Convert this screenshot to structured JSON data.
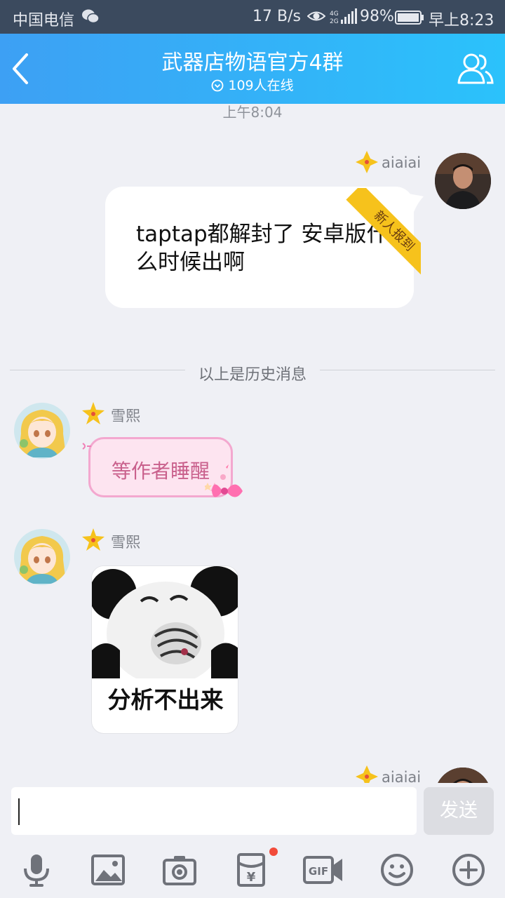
{
  "status_bar": {
    "carrier": "中国电信",
    "net_speed": "17 B/s",
    "network_type_top": "4G",
    "network_type_bottom": "2G",
    "battery": "98%",
    "time": "早上8:23"
  },
  "header": {
    "title": "武器店物语官方4群",
    "online": "109人在线"
  },
  "chat": {
    "time_label": "上午8:04",
    "history_divider": "以上是历史消息",
    "messages": [
      {
        "sender": "aiaiai",
        "side": "right",
        "text": "taptap都解封了  安卓版什么时候出啊",
        "ribbon": "新人报到"
      },
      {
        "sender": "雪熙",
        "side": "left",
        "text": "等作者睡醒"
      },
      {
        "sender": "雪熙",
        "side": "left",
        "sticker_caption": "分析不出来"
      },
      {
        "sender": "aiaiai",
        "side": "right"
      }
    ]
  },
  "input": {
    "value": "",
    "send_label": "发送"
  },
  "toolbar": {
    "gif_label": "GIF",
    "red_packet_symbol": "¥"
  },
  "colors": {
    "header_gradient_start": "#3da0f4",
    "header_gradient_end": "#2bc2fb",
    "status_bar": "#3b4a5e",
    "chat_bg": "#eff0f5",
    "pink_bubble": "#fde4f0",
    "ribbon": "#f6c21c",
    "unread_dot": "#f24b3a"
  }
}
